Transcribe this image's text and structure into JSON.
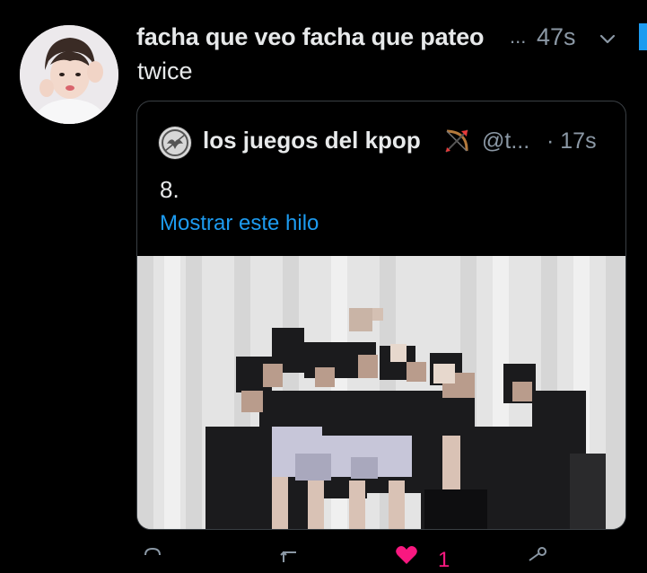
{
  "tweet": {
    "author_display_name": "facha que veo facha que pateo",
    "name_truncation": "...",
    "timestamp": "47s",
    "text": "twice",
    "more_icon": "chevron-down-icon",
    "avatar_icon": "user-avatar"
  },
  "quoted_tweet": {
    "author_display_name": "los juegos del kpop",
    "author_emoji": "bow-and-arrow-icon",
    "handle": "@t...",
    "time": "· 17s",
    "text": "8.",
    "show_thread_label": "Mostrar este hilo",
    "media_description_icon": "pixelated-photo"
  },
  "actions": {
    "reply_icon": "reply-icon",
    "retweet_icon": "retweet-icon",
    "like_icon": "heart-icon",
    "like_count": "1",
    "share_icon": "share-icon"
  },
  "colors": {
    "background": "#000000",
    "primary_text": "#e7e9ea",
    "secondary_text": "#8b98a5",
    "link": "#1d9bf0",
    "like": "#f91880",
    "card_border": "#3a3f44"
  }
}
